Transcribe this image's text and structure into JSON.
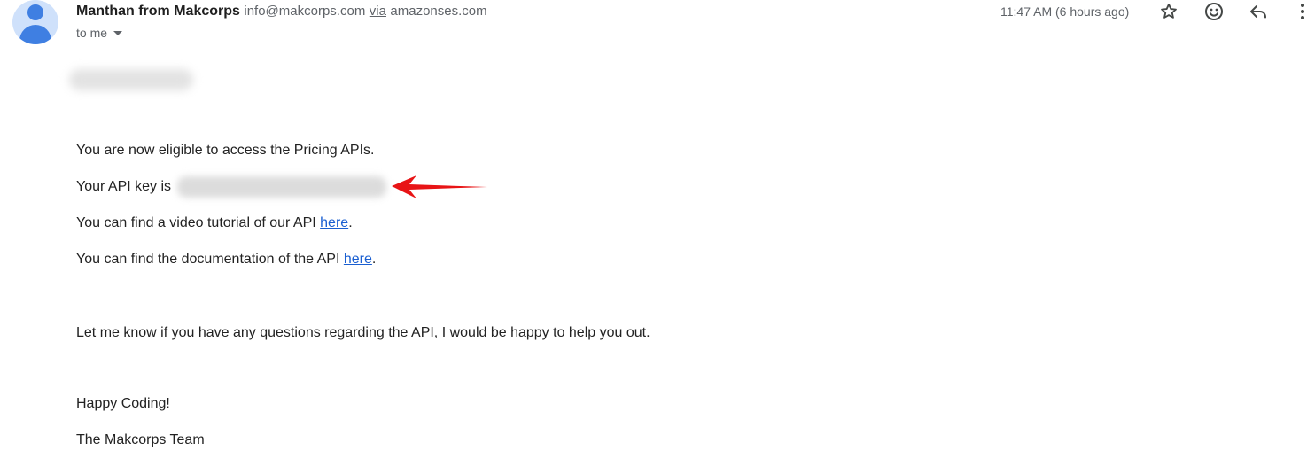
{
  "header": {
    "sender_name": "Manthan from Makcorps",
    "sender_email": "info@makcorps.com",
    "via_label": "via",
    "via_domain": "amazonses.com",
    "to_label": "to me",
    "timestamp": "11:47 AM (6 hours ago)",
    "icons": {
      "avatar": "person-avatar",
      "star": "star-icon",
      "emoji": "emoji-icon",
      "reply": "reply-icon",
      "more": "more-vert-icon"
    }
  },
  "body": {
    "line_eligible": "You are now eligible to access the Pricing APIs.",
    "api_key_label": "Your API key is",
    "video_text": "You can find a video tutorial of our API ",
    "video_link": "here",
    "docs_text": "You can find the documentation of the API ",
    "docs_link": "here",
    "period": ".",
    "questions": "Let me know if you have any questions regarding the API, I would be happy to help you out.",
    "signoff": "Happy Coding!",
    "team": "The Makcorps Team"
  },
  "colors": {
    "avatar_bg": "#cfe1fb",
    "avatar_fg": "#3f7fe2",
    "link": "#1a5fd1",
    "annotation_arrow": "#e81416"
  }
}
